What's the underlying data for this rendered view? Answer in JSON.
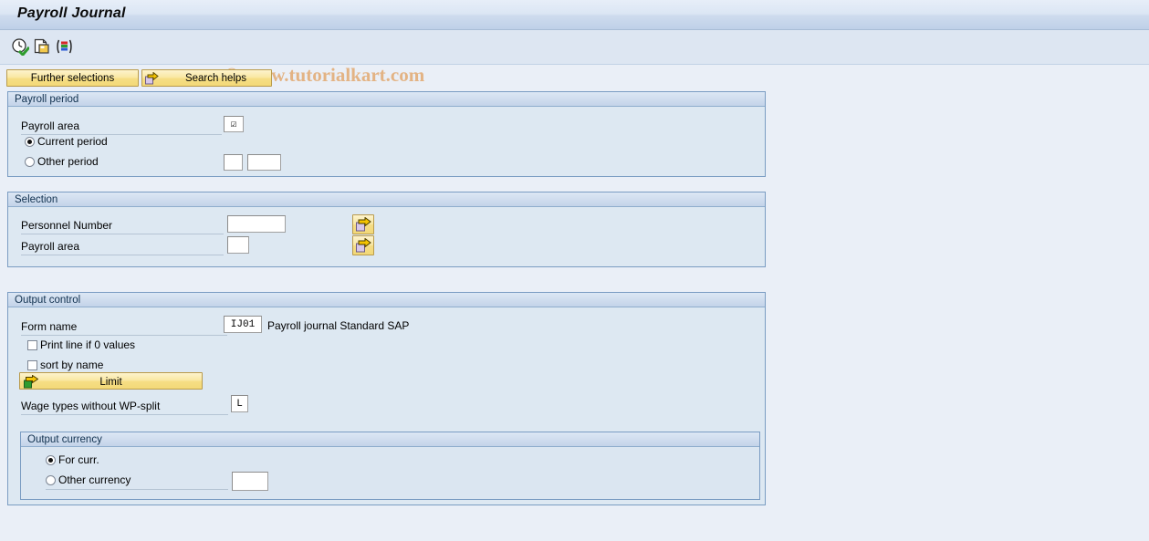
{
  "window": {
    "title": "Payroll Journal"
  },
  "watermark": {
    "text": "© www.tutorialkart.com",
    "color": "#e3b384"
  },
  "toolbar": {
    "icons": [
      {
        "name": "execute-icon",
        "title": "Execute"
      },
      {
        "name": "get-variant-icon",
        "title": "Get Variant"
      },
      {
        "name": "display-layout-icon",
        "title": "Layout"
      }
    ]
  },
  "buttons": {
    "further_selections": "Further selections",
    "search_helps": "Search helps"
  },
  "payroll_period": {
    "legend": "Payroll period",
    "payroll_area_label": "Payroll area",
    "payroll_area_value": "☑",
    "current_period_label": "Current period",
    "current_period_selected": true,
    "other_period_label": "Other period",
    "other_period_selected": false,
    "other_period_value_1": "",
    "other_period_value_2": ""
  },
  "selection": {
    "legend": "Selection",
    "personnel_number_label": "Personnel Number",
    "personnel_number_value": "",
    "payroll_area_label": "Payroll area",
    "payroll_area_value": "",
    "multi_select_title": "Multiple selection"
  },
  "output_control": {
    "legend": "Output control",
    "form_name_label": "Form name",
    "form_name_value": "IJ01",
    "form_name_description": "Payroll journal Standard SAP",
    "print_line_label": "Print line if 0 values",
    "print_line_checked": false,
    "sort_by_name_label": "sort by name",
    "sort_by_name_checked": false,
    "limit_button_label": "Limit",
    "wage_types_label": "Wage types without WP-split",
    "wage_types_value": "L",
    "output_currency": {
      "legend": "Output currency",
      "for_curr_label": "For curr.",
      "for_curr_selected": true,
      "other_currency_label": "Other currency",
      "other_currency_selected": false,
      "other_currency_value": ""
    }
  },
  "theme": {
    "page_background": "#eaeff7",
    "group_background": "#dde8f2",
    "group_border": "#7a9cc2",
    "button_yellow": "#f6de86",
    "title_text": "#0a0a0a"
  }
}
